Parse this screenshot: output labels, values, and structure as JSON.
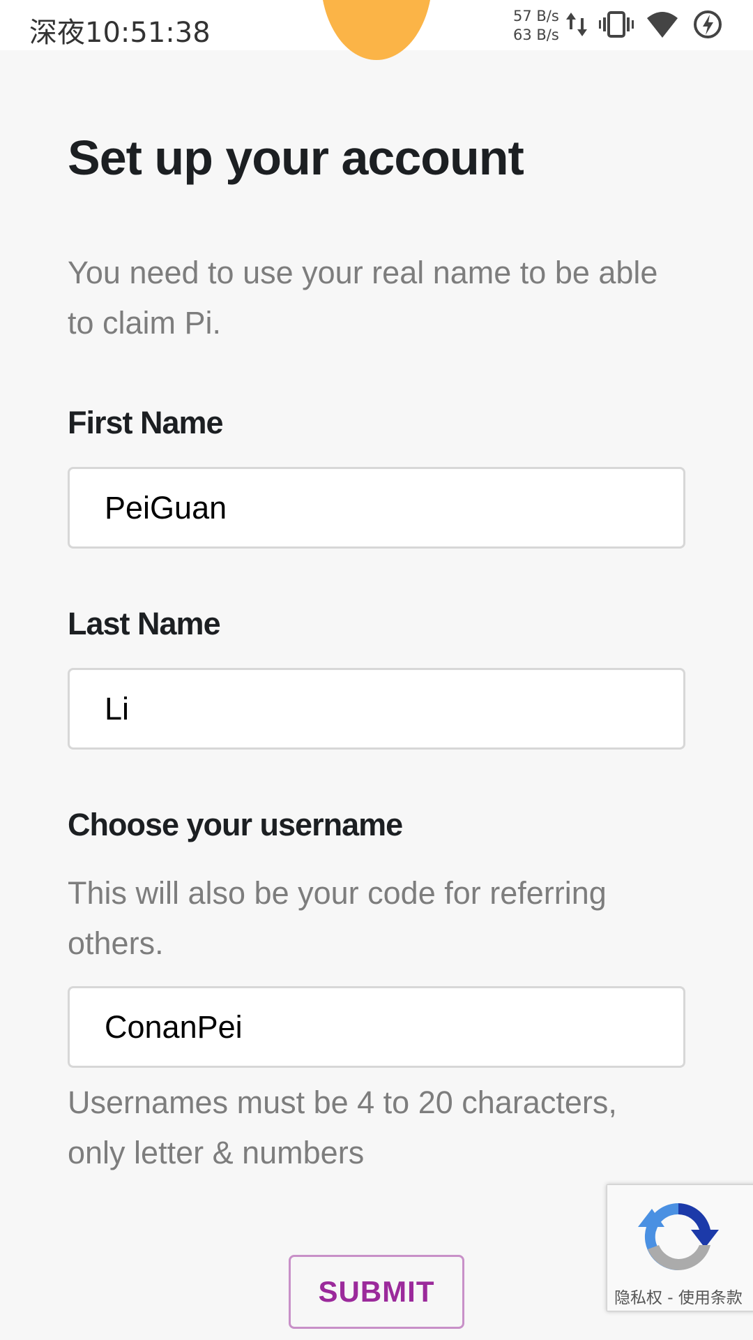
{
  "status_bar": {
    "time": "深夜10:51:38",
    "upload_speed": "57 B/s",
    "download_speed": "63 B/s",
    "icons": [
      "data-transfer-icon",
      "vibrate-icon",
      "wifi-icon",
      "battery-saver-icon"
    ]
  },
  "page": {
    "title": "Set up your account",
    "description": "You need to use your real name to be able to claim Pi."
  },
  "form": {
    "first_name": {
      "label": "First Name",
      "value": "PeiGuan"
    },
    "last_name": {
      "label": "Last Name",
      "value": "Li"
    },
    "username": {
      "label": "Choose your username",
      "description": "This will also be your code for referring others.",
      "value": "ConanPei",
      "hint": "Usernames must be 4 to 20 characters, only letter & numbers"
    },
    "submit_label": "SUBMIT"
  },
  "recaptcha": {
    "privacy": "隐私权",
    "separator": " - ",
    "terms": "使用条款"
  },
  "colors": {
    "background": "#f7f7f7",
    "logo": "#fbb447",
    "accent": "#9b2a9b",
    "button_border": "#c890c8",
    "title_text": "#1c1f22",
    "secondary_text": "#7d7d7d"
  }
}
